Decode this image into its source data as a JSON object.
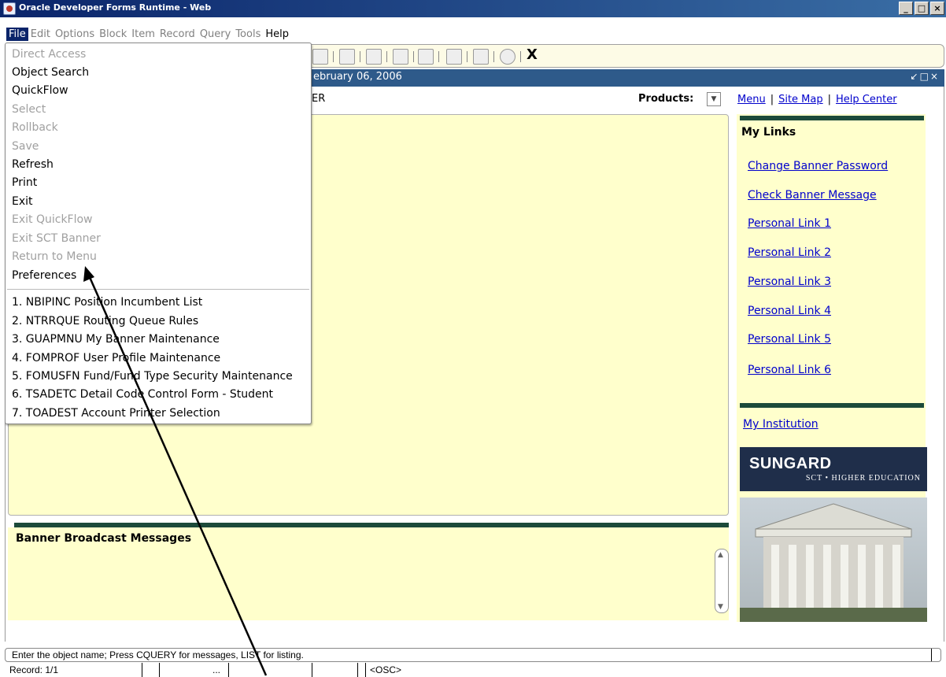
{
  "window": {
    "title": "Oracle Developer Forms Runtime - Web",
    "buttons": [
      "_",
      "□",
      "×"
    ]
  },
  "menubar": {
    "items": [
      "File",
      "Edit",
      "Options",
      "Block",
      "Item",
      "Record",
      "Query",
      "Tools",
      "Help"
    ]
  },
  "toolbar": {
    "close_label": "X"
  },
  "inner_window": {
    "date_fragment": "ebruary 06, 2006",
    "controls": "↙□×"
  },
  "header": {
    "fragment": "ER",
    "products_label": "Products:",
    "links": [
      "Menu",
      "Site Map",
      "Help Center"
    ]
  },
  "file_menu": {
    "items": [
      {
        "label": "Direct Access",
        "enabled": false
      },
      {
        "label": "Object Search",
        "enabled": true
      },
      {
        "label": "QuickFlow",
        "enabled": true
      },
      {
        "label": "Select",
        "enabled": false
      },
      {
        "label": "Rollback",
        "enabled": false
      },
      {
        "label": "Save",
        "enabled": false
      },
      {
        "label": "Refresh",
        "enabled": true
      },
      {
        "label": "Print",
        "enabled": true
      },
      {
        "label": "Exit",
        "enabled": true
      },
      {
        "label": "Exit QuickFlow",
        "enabled": false
      },
      {
        "label": "Exit SCT Banner",
        "enabled": false
      },
      {
        "label": "Return to Menu",
        "enabled": false
      },
      {
        "label": "Preferences",
        "enabled": true
      }
    ],
    "recent": [
      "1. NBIPINC Position Incumbent List",
      "2. NTRRQUE Routing Queue Rules",
      "3. GUAPMNU My Banner Maintenance",
      "4. FOMPROF User Profile Maintenance",
      "5. FOMUSFN Fund/Fund Type Security Maintenance",
      "6. TSADETC Detail Code Control Form - Student",
      "7. TOADEST Account Printer Selection"
    ]
  },
  "my_links": {
    "title": "My Links",
    "items": [
      "Change Banner Password",
      "Check Banner Message",
      "Personal Link 1",
      "Personal Link 2",
      "Personal Link 3",
      "Personal Link 4",
      "Personal Link 5",
      "Personal Link 6"
    ],
    "institution": "My Institution"
  },
  "logo": {
    "brand": "SUNGARD",
    "tagline": "SCT • HIGHER EDUCATION"
  },
  "broadcast": {
    "title": "Banner Broadcast Messages"
  },
  "status": {
    "message": "Enter the object name; Press CQUERY for messages, LIST for listing.",
    "record": "Record: 1/1",
    "ellipsis": "...",
    "osc": "<OSC>"
  }
}
